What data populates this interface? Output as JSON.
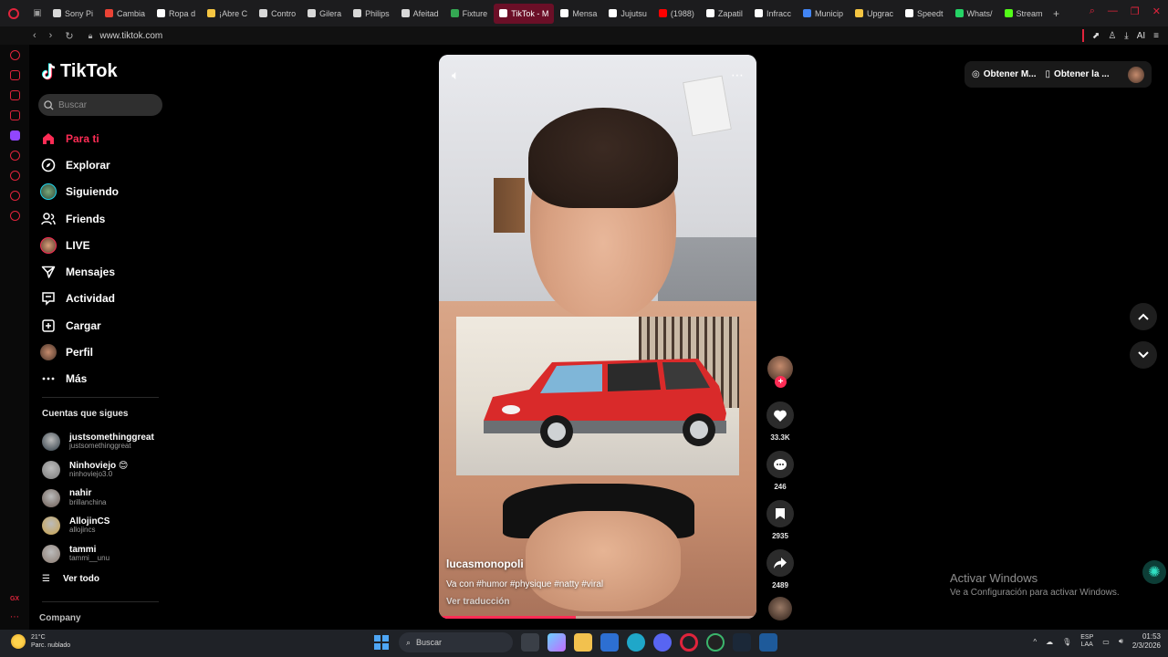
{
  "browser": {
    "tabs": [
      {
        "label": "Sony Pi",
        "color": "#d8d8d8"
      },
      {
        "label": "Cambia",
        "color": "#ea4335"
      },
      {
        "label": "Ropa d",
        "color": "#ffffff"
      },
      {
        "label": "¡Abre C",
        "color": "#f5c542"
      },
      {
        "label": "Contro",
        "color": "#d8d8d8"
      },
      {
        "label": "Gilera",
        "color": "#d8d8d8"
      },
      {
        "label": "Philips",
        "color": "#d8d8d8"
      },
      {
        "label": "Afeitad",
        "color": "#d8d8d8"
      },
      {
        "label": "Fixture",
        "color": "#34a853"
      },
      {
        "label": "TikTok - M",
        "color": "#ffffff",
        "active": true
      },
      {
        "label": "Mensa",
        "color": "#ffffff"
      },
      {
        "label": "Jujutsu",
        "color": "#ffffff"
      },
      {
        "label": "(1988)",
        "color": "#ff0000"
      },
      {
        "label": "Zapatil",
        "color": "#ffffff"
      },
      {
        "label": "Infracc",
        "color": "#ffffff"
      },
      {
        "label": "Municip",
        "color": "#4285f4"
      },
      {
        "label": "Upgrac",
        "color": "#f5c542"
      },
      {
        "label": "Speedt",
        "color": "#ffffff"
      },
      {
        "label": "Whats/",
        "color": "#25d366"
      },
      {
        "label": "Stream",
        "color": "#53fc18"
      }
    ],
    "url": "www.tiktok.com",
    "ai_label": "AI"
  },
  "sidebar": {
    "brand": "TikTok",
    "search_placeholder": "Buscar",
    "menu": [
      {
        "label": "Para ti",
        "icon": "home-icon",
        "active": true
      },
      {
        "label": "Explorar",
        "icon": "compass-icon"
      },
      {
        "label": "Siguiendo",
        "icon": "following-avatar-icon"
      },
      {
        "label": "Friends",
        "icon": "friends-icon"
      },
      {
        "label": "LIVE",
        "icon": "live-avatar-icon"
      },
      {
        "label": "Mensajes",
        "icon": "messages-icon"
      },
      {
        "label": "Actividad",
        "icon": "activity-icon"
      },
      {
        "label": "Cargar",
        "icon": "upload-icon"
      },
      {
        "label": "Perfil",
        "icon": "profile-avatar-icon"
      },
      {
        "label": "Más",
        "icon": "more-icon"
      }
    ],
    "following_title": "Cuentas que sigues",
    "following": [
      {
        "name": "justsomethinggreat",
        "handle": "justsomethinggreat",
        "color": "#2d3a44"
      },
      {
        "name": "Ninhoviejo 😊",
        "handle": "ninhoviejo3.0",
        "color": "#7a7a7a"
      },
      {
        "name": "nahir",
        "handle": "brillanchina",
        "color": "#6a5a52"
      },
      {
        "name": "AllojinCS",
        "handle": "allojincs",
        "color": "#c9a24a"
      },
      {
        "name": "tammi",
        "handle": "tammi__unu",
        "color": "#8a7a70"
      }
    ],
    "see_all": "Ver todo",
    "company": "Company"
  },
  "video": {
    "author": "lucasmonopoli",
    "description": "Va con #humor #physique #natty #viral",
    "translate": "Ver traducción",
    "progress": 0.43,
    "likes": "33.3K",
    "comments": "246",
    "saves": "2935",
    "shares": "2489"
  },
  "topbar": {
    "get_coins": "Obtener M...",
    "get_app": "Obtener la ..."
  },
  "watermark": {
    "line1": "Activar Windows",
    "line2": "Ve a Configuración para activar Windows."
  },
  "taskbar": {
    "temp": "21°C",
    "weather": "Parc. nublado",
    "search": "Buscar",
    "lang1": "ESP",
    "lang2": "LAA",
    "time": "01:53",
    "date": "2/3/2026"
  }
}
